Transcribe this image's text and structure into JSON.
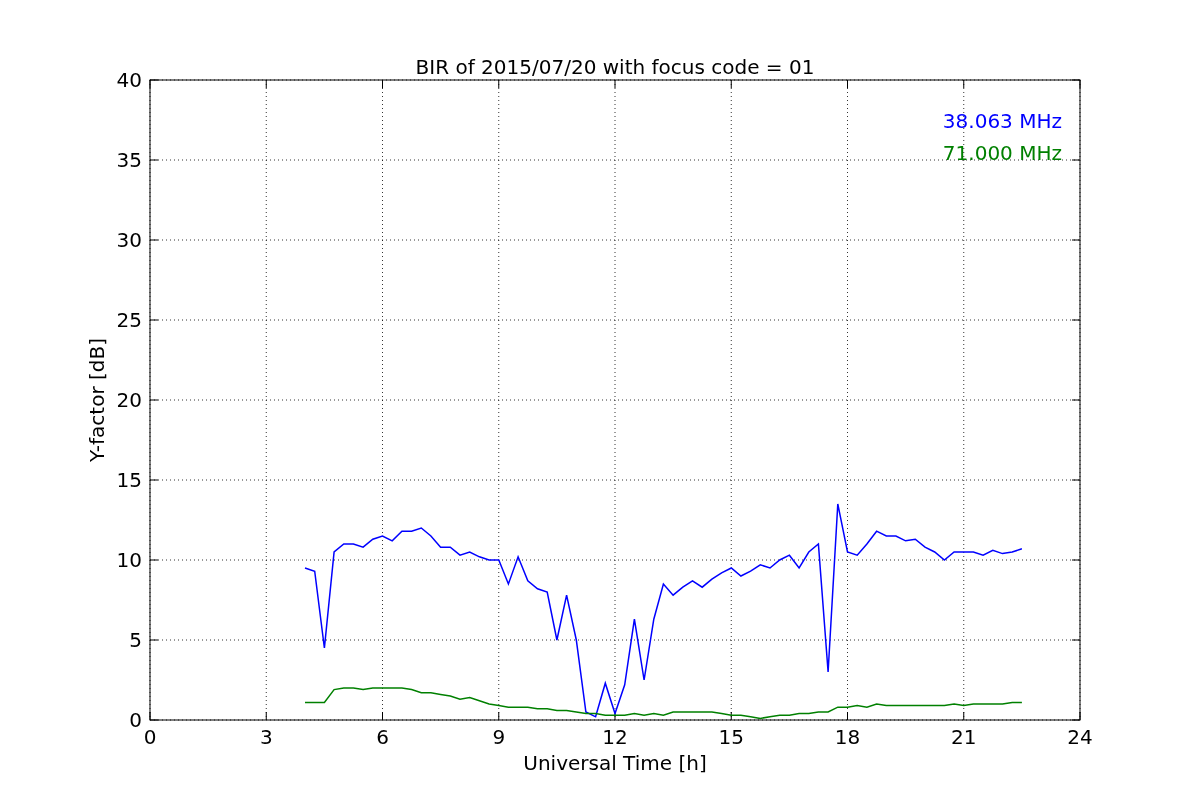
{
  "figure": {
    "chart_data": {
      "type": "line",
      "title": "BIR of 2015/07/20 with focus code = 01",
      "xlabel": "Universal Time [h]",
      "ylabel": "Y-factor [dB]",
      "x": [
        4.0,
        4.25,
        4.5,
        4.75,
        5.0,
        5.25,
        5.5,
        5.75,
        6.0,
        6.25,
        6.5,
        6.75,
        7.0,
        7.25,
        7.5,
        7.75,
        8.0,
        8.25,
        8.5,
        8.75,
        9.0,
        9.25,
        9.5,
        9.75,
        10.0,
        10.25,
        10.5,
        10.75,
        11.0,
        11.25,
        11.5,
        11.75,
        12.0,
        12.25,
        12.5,
        12.75,
        13.0,
        13.25,
        13.5,
        13.75,
        14.0,
        14.25,
        14.5,
        14.75,
        15.0,
        15.25,
        15.5,
        15.75,
        16.0,
        16.25,
        16.5,
        16.75,
        17.0,
        17.25,
        17.5,
        17.75,
        18.0,
        18.25,
        18.5,
        18.75,
        19.0,
        19.25,
        19.5,
        19.75,
        20.0,
        20.25,
        20.5,
        20.75,
        21.0,
        21.25,
        21.5,
        21.75,
        22.0,
        22.25,
        22.5
      ],
      "series": [
        {
          "name": "38.063 MHz",
          "color": "#0000ff",
          "values": [
            9.5,
            9.3,
            4.5,
            10.5,
            11,
            11,
            10.8,
            11.3,
            11.5,
            11.2,
            11.8,
            11.8,
            12,
            11.5,
            10.8,
            10.8,
            10.3,
            10.5,
            10.2,
            10,
            10,
            8.5,
            10.2,
            8.7,
            8.2,
            8,
            5,
            7.8,
            5,
            0.5,
            0.2,
            2.3,
            0.4,
            2.2,
            6.3,
            2.5,
            6.3,
            8.5,
            7.8,
            8.3,
            8.7,
            8.3,
            8.8,
            9.2,
            9.5,
            9,
            9.3,
            9.7,
            9.5,
            10,
            10.3,
            9.5,
            10.5,
            11,
            3,
            13.5,
            10.5,
            10.3,
            11,
            11.8,
            11.5,
            11.5,
            11.2,
            11.3,
            10.8,
            10.5,
            10,
            10.5,
            10.5,
            10.5,
            10.3,
            10.6,
            10.4,
            10.5,
            10.7
          ]
        },
        {
          "name": "71.000 MHz",
          "color": "#008000",
          "values": [
            1.1,
            1.1,
            1.1,
            1.9,
            2,
            2,
            1.9,
            2,
            2,
            2,
            2,
            1.9,
            1.7,
            1.7,
            1.6,
            1.5,
            1.3,
            1.4,
            1.2,
            1,
            0.9,
            0.8,
            0.8,
            0.8,
            0.7,
            0.7,
            0.6,
            0.6,
            0.5,
            0.4,
            0.4,
            0.3,
            0.3,
            0.3,
            0.4,
            0.3,
            0.4,
            0.3,
            0.5,
            0.5,
            0.5,
            0.5,
            0.5,
            0.4,
            0.3,
            0.3,
            0.2,
            0.1,
            0.2,
            0.3,
            0.3,
            0.4,
            0.4,
            0.5,
            0.5,
            0.8,
            0.8,
            0.9,
            0.8,
            1,
            0.9,
            0.9,
            0.9,
            0.9,
            0.9,
            0.9,
            0.9,
            1,
            0.9,
            1,
            1,
            1,
            1,
            1.1,
            1.1
          ]
        }
      ],
      "grid": true,
      "xlim": [
        0,
        24
      ],
      "ylim": [
        0,
        40
      ],
      "xticks": [
        0,
        3,
        6,
        9,
        12,
        15,
        18,
        21,
        24
      ],
      "yticks": [
        0,
        5,
        10,
        15,
        20,
        25,
        30,
        35,
        40
      ]
    }
  }
}
